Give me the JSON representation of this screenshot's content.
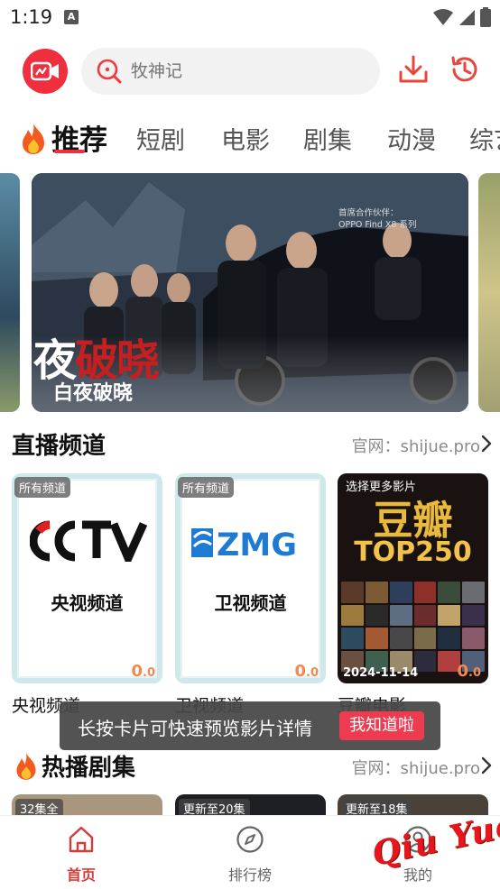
{
  "status_bar": {
    "time": "1:19",
    "notification_letter": "A"
  },
  "search": {
    "placeholder": "牧神记"
  },
  "tabs": [
    {
      "label": "推荐",
      "active": true
    },
    {
      "label": "短剧"
    },
    {
      "label": "电影"
    },
    {
      "label": "剧集"
    },
    {
      "label": "动漫"
    },
    {
      "label": "综艺"
    }
  ],
  "banner": {
    "caption": "白夜破晓",
    "calligraphy_left": "夜",
    "calligraphy_right": "破晓",
    "sponsor_line1": "首席合作伙伴：",
    "sponsor_line2": "OPPO Find X8 系列"
  },
  "live_section": {
    "title": "直播频道",
    "link": "官网：shijue.pro",
    "cards": [
      {
        "tag": "所有频道",
        "logo_text": "CCTV",
        "name_in_card": "央视频道",
        "score_int": "0",
        "score_dec": ".0",
        "label": "央视频道"
      },
      {
        "tag": "所有频道",
        "logo_text": "ZMG",
        "name_in_card": "卫视频道",
        "score_int": "0",
        "score_dec": ".0",
        "label": "卫视频道"
      },
      {
        "tag": "选择更多影片",
        "big_text": "豆瓣",
        "sub_text": "TOP250",
        "date": "2024-11-14",
        "score_int": "0",
        "score_dec": ".0",
        "label": "豆瓣电影"
      }
    ]
  },
  "toast": {
    "text": "长按卡片可快速预览影片详情",
    "button": "我知道啦"
  },
  "hot_section": {
    "title": "热播剧集",
    "link": "官网：shijue.pro",
    "cards": [
      {
        "tag": "32集全"
      },
      {
        "tag": "更新至20集"
      },
      {
        "tag": "更新至18集"
      }
    ]
  },
  "bottom_nav": [
    {
      "label": "首页",
      "icon": "home-icon",
      "active": true
    },
    {
      "label": "排行榜",
      "icon": "compass-icon"
    },
    {
      "label": "我的",
      "icon": "user-icon"
    }
  ],
  "watermark": {
    "text": "Qiu Yue"
  },
  "colors": {
    "accent": "#ef2f3d",
    "score": "#f08a52",
    "toast_button": "#ef3b50"
  }
}
